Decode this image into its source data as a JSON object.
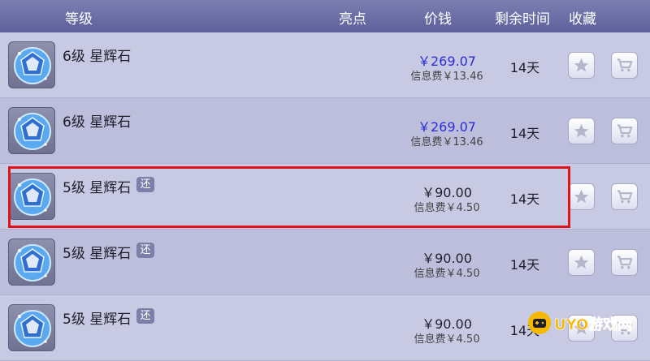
{
  "header": {
    "level": "等级",
    "highlight": "亮点",
    "price": "价钱",
    "remaining_time": "剩余时间",
    "favorite": "收藏"
  },
  "items": [
    {
      "name": "6级 星辉石",
      "badge": "",
      "price": "￥269.07",
      "fee": "信息费￥13.46",
      "time": "14天",
      "price_color": "#2b2bd6"
    },
    {
      "name": "6级 星辉石",
      "badge": "",
      "price": "￥269.07",
      "fee": "信息费￥13.46",
      "time": "14天",
      "price_color": "#2b2bd6"
    },
    {
      "name": "5级 星辉石",
      "badge": "还",
      "price": "￥90.00",
      "fee": "信息费￥4.50",
      "time": "14天",
      "price_color": "#1e1e2a"
    },
    {
      "name": "5级 星辉石",
      "badge": "还",
      "price": "￥90.00",
      "fee": "信息费￥4.50",
      "time": "14天",
      "price_color": "#1e1e2a"
    },
    {
      "name": "5级 星辉石",
      "badge": "还",
      "price": "￥90.00",
      "fee": "信息费￥4.50",
      "time": "14天",
      "price_color": "#1e1e2a"
    }
  ],
  "icons": {
    "gem": "gem-icon",
    "favorite": "star-icon",
    "buy": "cart-icon"
  },
  "watermark": {
    "text": "UYO游戏网"
  },
  "colors": {
    "header_bg": "#6c6fa8",
    "highlight_border": "#e0121a",
    "blue_price": "#2b2bd6"
  }
}
